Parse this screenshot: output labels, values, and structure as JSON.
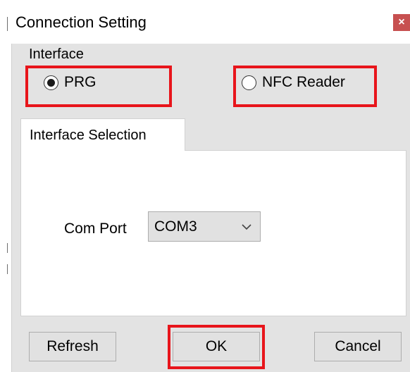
{
  "window": {
    "title": "Connection Setting",
    "close_glyph": "×"
  },
  "interface": {
    "group_label": "Interface",
    "options": [
      {
        "label": "PRG",
        "selected": true
      },
      {
        "label": "NFC Reader",
        "selected": false
      }
    ]
  },
  "tabs": [
    {
      "label": "Interface Selection",
      "active": true
    }
  ],
  "com_port": {
    "label": "Com Port",
    "selected_value": "COM3"
  },
  "buttons": {
    "refresh": "Refresh",
    "ok": "OK",
    "cancel": "Cancel"
  },
  "colors": {
    "highlight": "#e8151b",
    "close_button": "#c75050",
    "dialog_background": "#e3e3e3",
    "button_face": "#e1e1e1"
  },
  "icons": {
    "close": "close-icon",
    "dropdown": "chevron-down-icon",
    "radio": "radio-button-icon"
  }
}
